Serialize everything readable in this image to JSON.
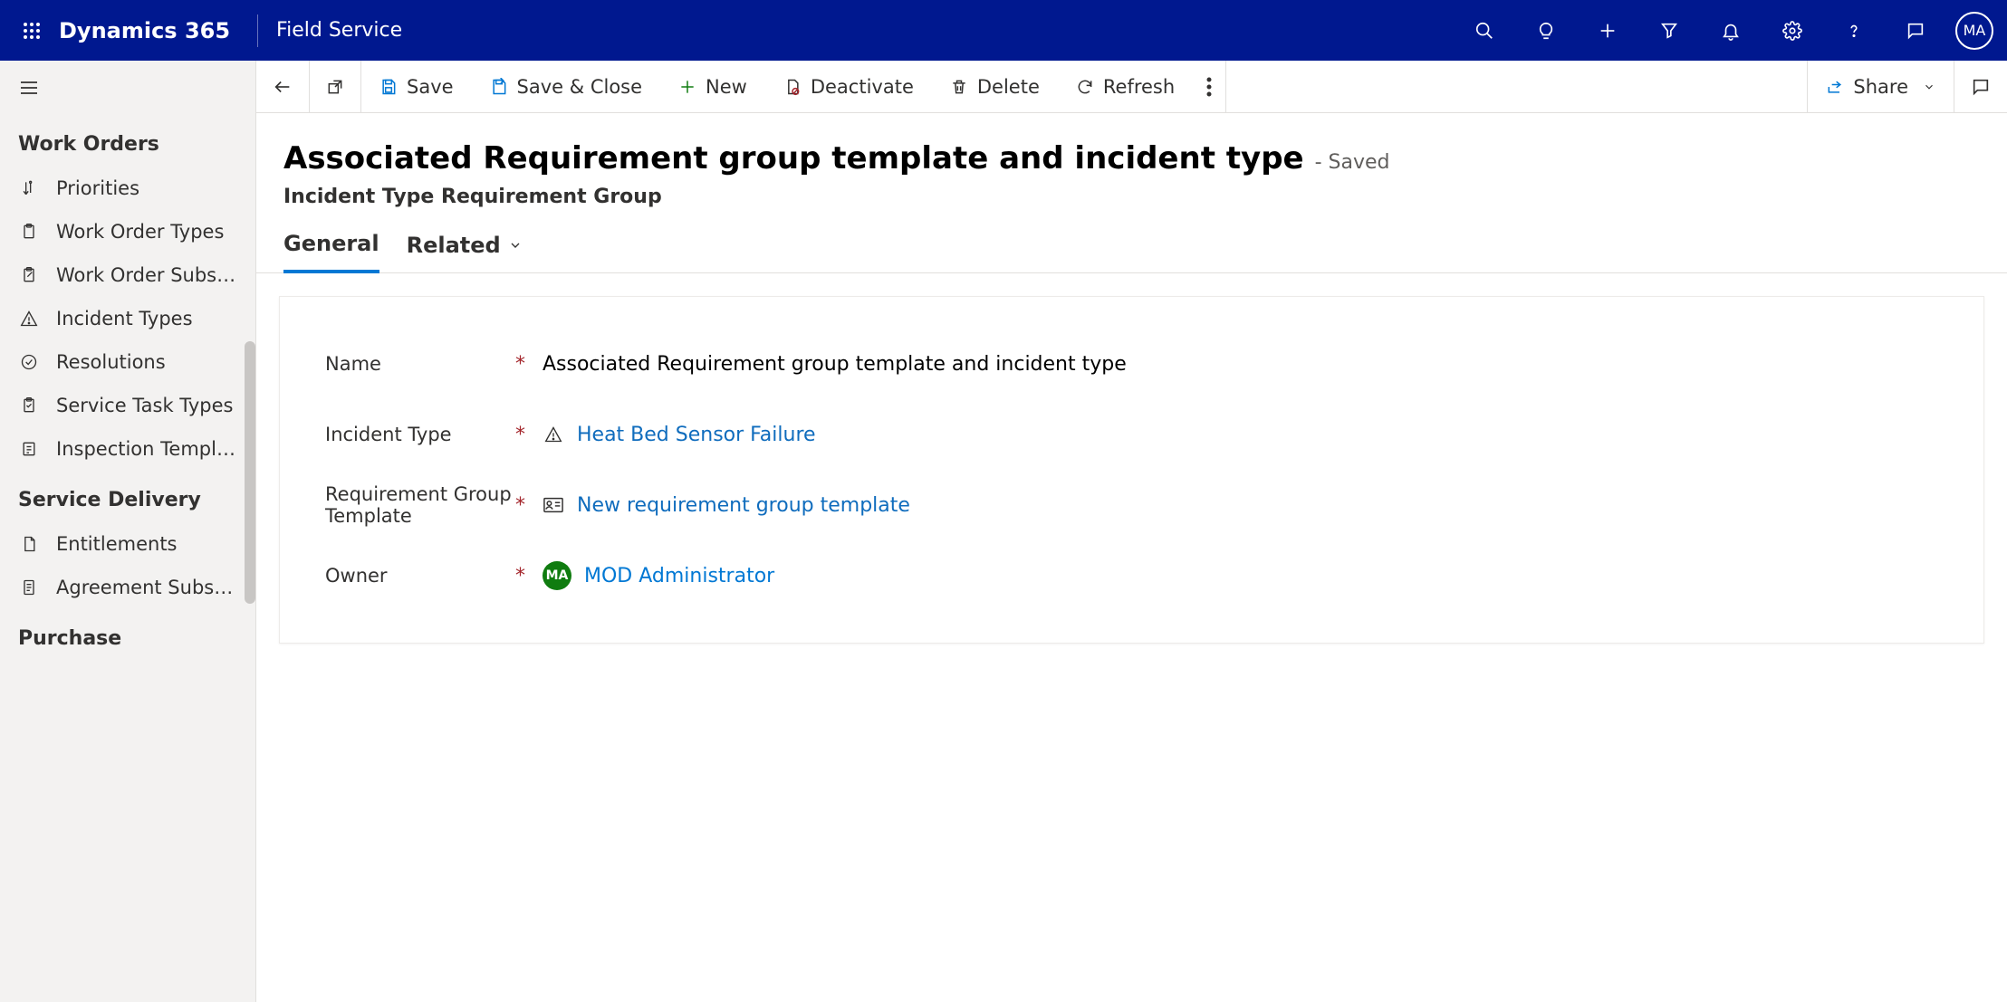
{
  "header": {
    "brand": "Dynamics 365",
    "appName": "Field Service",
    "avatarInitials": "MA"
  },
  "sidebar": {
    "sections": [
      {
        "title": "Work Orders",
        "items": [
          {
            "label": "Priorities",
            "icon": "priority"
          },
          {
            "label": "Work Order Types",
            "icon": "clipboard"
          },
          {
            "label": "Work Order Subst...",
            "icon": "clipboard-edit"
          },
          {
            "label": "Incident Types",
            "icon": "warning"
          },
          {
            "label": "Resolutions",
            "icon": "check-circle"
          },
          {
            "label": "Service Task Types",
            "icon": "task"
          },
          {
            "label": "Inspection Templa...",
            "icon": "template"
          }
        ]
      },
      {
        "title": "Service Delivery",
        "items": [
          {
            "label": "Entitlements",
            "icon": "doc"
          },
          {
            "label": "Agreement Subst...",
            "icon": "page"
          }
        ]
      },
      {
        "title": "Purchase",
        "items": []
      }
    ]
  },
  "commandBar": {
    "save": "Save",
    "saveClose": "Save & Close",
    "new": "New",
    "deactivate": "Deactivate",
    "delete": "Delete",
    "refresh": "Refresh",
    "share": "Share"
  },
  "record": {
    "title": "Associated Requirement group template and incident type",
    "savedLabel": "- Saved",
    "entity": "Incident Type Requirement Group"
  },
  "tabs": {
    "general": "General",
    "related": "Related"
  },
  "form": {
    "fields": {
      "name": {
        "label": "Name",
        "value": "Associated Requirement group template and incident type"
      },
      "incidentType": {
        "label": "Incident Type",
        "value": "Heat Bed Sensor Failure"
      },
      "reqGroupTemplate": {
        "label": "Requirement Group Template",
        "value": "New requirement group template"
      },
      "owner": {
        "label": "Owner",
        "value": "MOD Administrator",
        "initials": "MA"
      }
    }
  }
}
